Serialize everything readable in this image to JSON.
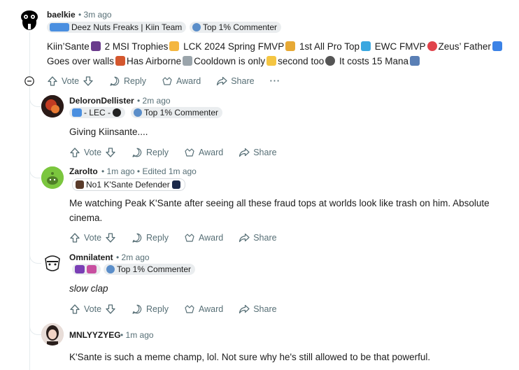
{
  "comments": [
    {
      "username": "baelkie",
      "time": "3m ago",
      "flair": "Deez Nuts Freaks | Kiin Team",
      "flair2": "Top 1% Commenter",
      "text_parts": [
        "Kiin’Sante",
        "2 MSI Trophies",
        "LCK 2024 Spring FMVP",
        "1st All Pro Top",
        "EWC FMVP",
        "Zeus’ Father",
        "Goes over walls",
        "Has Airborne",
        "Cooldown is only",
        "second too",
        "It costs 15 Mana"
      ]
    },
    {
      "username": "DeloronDellister",
      "time": "2m ago",
      "flair": "- LEC -",
      "flair2": "Top 1% Commenter",
      "text": "Giving Kiinsante...."
    },
    {
      "username": "Zarolto",
      "time": "1m ago",
      "edited": "Edited 1m ago",
      "flair": "No1 K'Sante Defender",
      "text": "Me watching Peak K'Sante after seeing all these fraud tops at worlds look like trash on him. Absolute cinema."
    },
    {
      "username": "Omnilatent",
      "time": "2m ago",
      "flair2": "Top 1% Commenter",
      "text": "slow clap"
    },
    {
      "username": "MNLYYZYEG",
      "time": "1m ago",
      "text": "K'Sante is such a meme champ, lol. Not sure why he's still allowed to be that powerful."
    }
  ],
  "actions": {
    "vote": "Vote",
    "reply": "Reply",
    "award": "Award",
    "share": "Share",
    "more": "···"
  },
  "separator": "•",
  "colors": {
    "text": "#1c1c1c",
    "meta": "#576f76",
    "flair_bg": "#eaedef",
    "thread_line": "#e5ebee"
  }
}
